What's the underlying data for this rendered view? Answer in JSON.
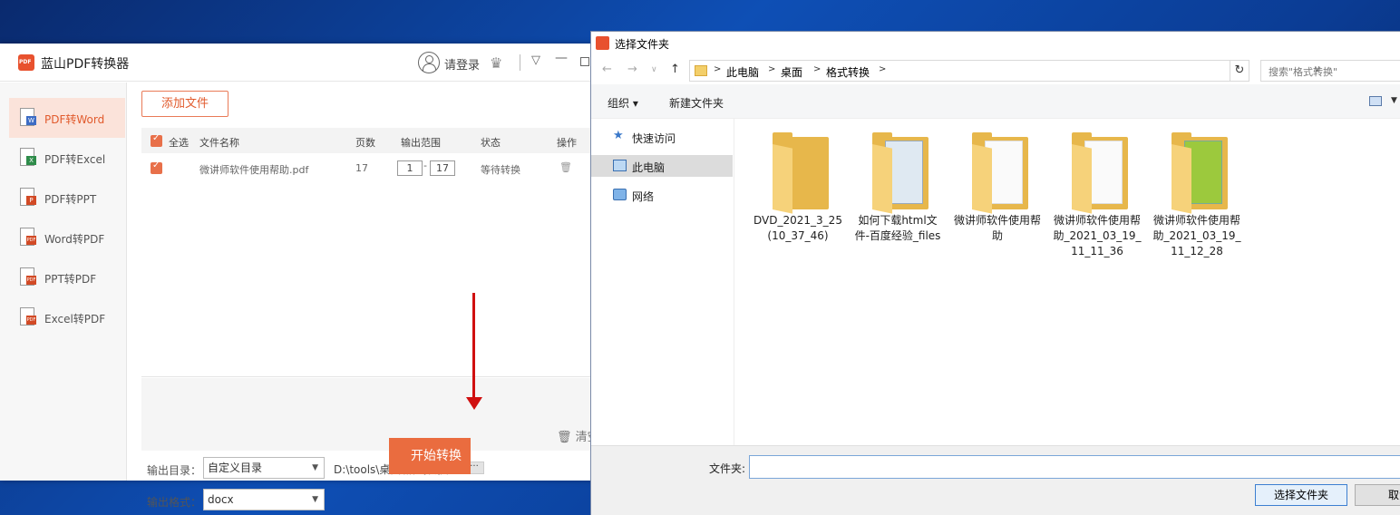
{
  "app": {
    "title": "蓝山PDF转换器",
    "login": "请登录",
    "sidebar": [
      {
        "label": "PDF转Word",
        "badge": "W",
        "color": "#3d6cc4"
      },
      {
        "label": "PDF转Excel",
        "badge": "X",
        "color": "#2e8c4a"
      },
      {
        "label": "PDF转PPT",
        "badge": "P",
        "color": "#d24a26"
      },
      {
        "label": "Word转PDF",
        "badge": "PDF",
        "color": "#d24a26"
      },
      {
        "label": "PPT转PDF",
        "badge": "PDF",
        "color": "#d24a26"
      },
      {
        "label": "Excel转PDF",
        "badge": "PDF",
        "color": "#d24a26"
      }
    ],
    "add_file": "添加文件",
    "table": {
      "headers": {
        "select_all": "全选",
        "name": "文件名称",
        "pages": "页数",
        "range": "输出范围",
        "status": "状态",
        "ops": "操作"
      },
      "rows": [
        {
          "name": "微讲师软件使用帮助.pdf",
          "pages": "17",
          "range_from": "1",
          "range_to": "17",
          "status": "等待转换"
        }
      ]
    },
    "clear": "清空",
    "output_dir_label": "输出目录：",
    "output_dir_value": "自定义目录",
    "output_path": "D:\\tools\\桌面\\格式转换",
    "dots": "···",
    "output_format_label": "输出格式：",
    "output_format_value": "docx",
    "start": "开始转换"
  },
  "dialog": {
    "title": "选择文件夹",
    "breadcrumbs": [
      "此电脑",
      "桌面",
      "格式转换"
    ],
    "search_placeholder": "搜索\"格式转换\"",
    "toolbar": {
      "organize": "组织 ▾",
      "new_folder": "新建文件夹"
    },
    "nav": [
      {
        "label": "快速访问",
        "icon": "star-icon"
      },
      {
        "label": "此电脑",
        "icon": "computer-icon"
      },
      {
        "label": "网络",
        "icon": "network-icon"
      }
    ],
    "files": [
      {
        "name": "DVD_2021_3_25 (10_37_46)"
      },
      {
        "name": "如何下载html文件-百度经验_files"
      },
      {
        "name": "微讲师软件使用帮助"
      },
      {
        "name": "微讲师软件使用帮助_2021_03_19_11_11_36"
      },
      {
        "name": "微讲师软件使用帮助_2021_03_19_11_12_28"
      }
    ],
    "folder_label": "文件夹:",
    "folder_value": "",
    "select_button": "选择文件夹",
    "cancel_button": "取消"
  }
}
